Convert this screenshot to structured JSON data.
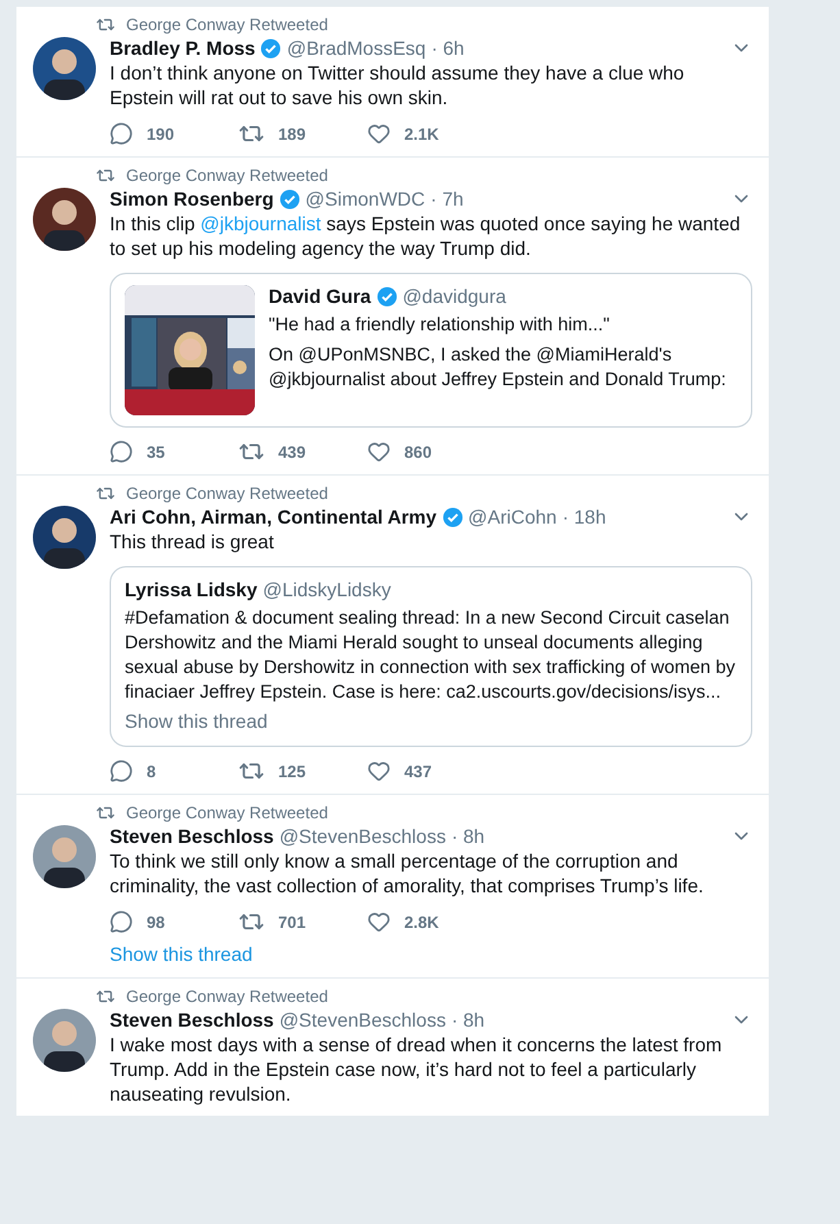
{
  "tweets": [
    {
      "context": "George Conway Retweeted",
      "name": "Bradley P. Moss",
      "verified": true,
      "handle": "@BradMossEsq",
      "time": "· 6h",
      "text": [
        {
          "kind": "plain",
          "text": "I don’t think anyone on Twitter should assume they have a clue who Epstein will rat out to save his own skin."
        }
      ],
      "replies": "190",
      "retweets": "189",
      "likes": "2.1K"
    },
    {
      "context": "George Conway Retweeted",
      "name": "Simon Rosenberg",
      "verified": true,
      "handle": "@SimonWDC",
      "time": "· 7h",
      "text": [
        {
          "kind": "plain",
          "text": "In this clip "
        },
        {
          "kind": "mention",
          "text": "@jkbjournalist"
        },
        {
          "kind": "plain",
          "text": " says Epstein was quoted once saying he wanted to set up his modeling agency the way Trump did."
        }
      ],
      "quote": {
        "name": "David Gura",
        "verified": true,
        "handle": "@davidgura",
        "media": {
          "kind": "picture"
        },
        "paragraphs": [
          "\"He had a friendly relationship with him...\"",
          "On @UPonMSNBC, I asked the @MiamiHerald's @jkbjournalist about Jeffrey Epstein and Donald Trump:"
        ]
      },
      "replies": "35",
      "retweets": "439",
      "likes": "860"
    },
    {
      "context": "George Conway Retweeted",
      "name": "Ari Cohn, Airman, Continental Army",
      "verified": true,
      "handle": "@AriCohn",
      "time": "· 18h",
      "text": [
        {
          "kind": "plain",
          "text": "This thread is great"
        }
      ],
      "quote": {
        "name": "Lyrissa Lidsky",
        "verified": false,
        "handle": "@LidskyLidsky",
        "paragraphs": [
          "#Defamation & document sealing thread: In a new Second Circuit caselan Dershowitz and the Miami Herald sought to unseal documents alleging sexual abuse by Dershowitz in connection with sex trafficking of women by finaciaer Jeffrey Epstein. Case is here: ca2.uscourts.gov/decisions/isys..."
        ],
        "thread_link": "Show this thread"
      },
      "replies": "8",
      "retweets": "125",
      "likes": "437"
    },
    {
      "context": "George Conway Retweeted",
      "name": "Steven Beschloss",
      "verified": false,
      "handle": "@StevenBeschloss",
      "time": "· 8h",
      "text": [
        {
          "kind": "plain",
          "text": "To think we still only know a small percentage of the corruption and criminality, the vast collection of amorality, that comprises Trump’s life."
        }
      ],
      "replies": "98",
      "retweets": "701",
      "likes": "2.8K",
      "thread_link": "Show this thread"
    },
    {
      "context": "George Conway Retweeted",
      "name": "Steven Beschloss",
      "verified": false,
      "handle": "@StevenBeschloss",
      "time": "· 8h",
      "text": [
        {
          "kind": "plain",
          "text": "I wake most days with a sense of dread when it concerns the latest from Trump. Add in the Epstein case now, it’s hard not to feel a particularly nauseating revulsion."
        }
      ]
    }
  ]
}
